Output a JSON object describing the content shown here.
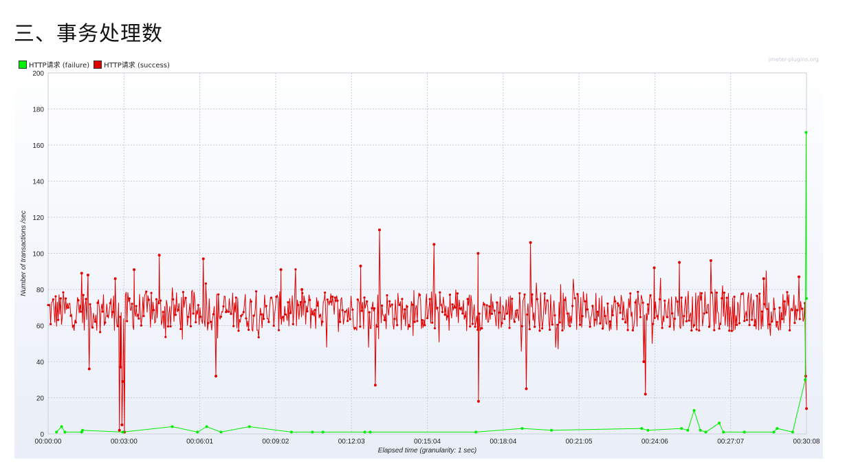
{
  "heading": "三、事务处理数",
  "watermark": "jmeter-plugins.org",
  "legend": [
    {
      "label": "HTTP请求 (failure)",
      "color": "#00ee00"
    },
    {
      "label": "HTTP请求 (success)",
      "color": "#e00000"
    }
  ],
  "chart_data": {
    "type": "line",
    "xlabel": "Elapsed time (granularity: 1 sec)",
    "ylabel": "Number of transactions /sec",
    "ylim": [
      0,
      200
    ],
    "xlim_seconds": [
      0,
      1808
    ],
    "y_ticks": [
      "0",
      "20",
      "40",
      "60",
      "80",
      "100",
      "120",
      "140",
      "160",
      "180",
      "200"
    ],
    "x_ticks": [
      "00:00:00",
      "00:03:00",
      "00:06:01",
      "00:09:02",
      "00:12:03",
      "00:15:04",
      "00:18:04",
      "00:21:05",
      "00:24:06",
      "00:27:07",
      "00:30:08"
    ],
    "grid": true,
    "legend_position": "top-left",
    "series": [
      {
        "name": "HTTP请求 (failure)",
        "color": "#00ee00",
        "points": [
          [
            20,
            1
          ],
          [
            32,
            4
          ],
          [
            40,
            1
          ],
          [
            80,
            1
          ],
          [
            82,
            2
          ],
          [
            178,
            1
          ],
          [
            296,
            4
          ],
          [
            356,
            1
          ],
          [
            378,
            4
          ],
          [
            412,
            1
          ],
          [
            480,
            4
          ],
          [
            580,
            1
          ],
          [
            630,
            1
          ],
          [
            655,
            1
          ],
          [
            755,
            1
          ],
          [
            768,
            1
          ],
          [
            1020,
            1
          ],
          [
            1130,
            3
          ],
          [
            1200,
            2
          ],
          [
            1415,
            3
          ],
          [
            1430,
            2
          ],
          [
            1510,
            3
          ],
          [
            1525,
            2
          ],
          [
            1540,
            13
          ],
          [
            1555,
            2
          ],
          [
            1568,
            1
          ],
          [
            1600,
            6
          ],
          [
            1610,
            1
          ],
          [
            1660,
            1
          ],
          [
            1730,
            1
          ],
          [
            1738,
            3
          ],
          [
            1775,
            1
          ],
          [
            1805,
            30
          ],
          [
            1807,
            167
          ],
          [
            1808,
            75
          ]
        ]
      },
      {
        "name": "HTTP请求 (success)",
        "color": "#e00000",
        "markers": [
          [
            80,
            89
          ],
          [
            95,
            88
          ],
          [
            98,
            36
          ],
          [
            160,
            86
          ],
          [
            170,
            2
          ],
          [
            173,
            37
          ],
          [
            176,
            5
          ],
          [
            178,
            29
          ],
          [
            182,
            1
          ],
          [
            205,
            91
          ],
          [
            265,
            99
          ],
          [
            370,
            97
          ],
          [
            400,
            32
          ],
          [
            555,
            91
          ],
          [
            605,
            80
          ],
          [
            745,
            93
          ],
          [
            780,
            27
          ],
          [
            790,
            113
          ],
          [
            920,
            105
          ],
          [
            1025,
            100
          ],
          [
            1026,
            18
          ],
          [
            1150,
            106
          ],
          [
            1140,
            25
          ],
          [
            1445,
            92
          ],
          [
            1420,
            40
          ],
          [
            1424,
            22
          ],
          [
            1505,
            95
          ],
          [
            1580,
            96
          ],
          [
            1706,
            86
          ],
          [
            1790,
            87
          ],
          [
            1806,
            32
          ],
          [
            1808,
            14
          ]
        ]
      }
    ]
  }
}
